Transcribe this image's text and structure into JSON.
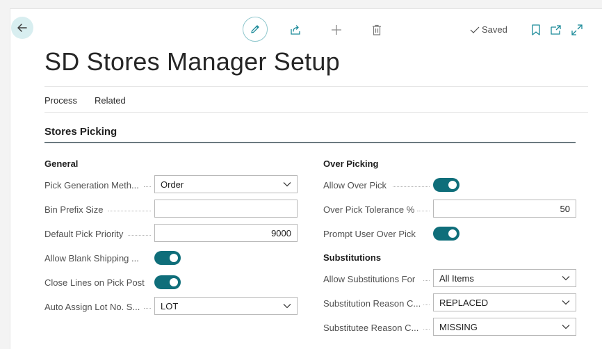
{
  "header": {
    "saved_label": "Saved"
  },
  "page_title": "SD Stores Manager Setup",
  "actions": {
    "process": "Process",
    "related": "Related"
  },
  "section": {
    "title": "Stores Picking"
  },
  "general": {
    "title": "General",
    "pick_generation_method": {
      "label": "Pick Generation Meth...",
      "value": "Order"
    },
    "bin_prefix_size": {
      "label": "Bin Prefix Size",
      "value": ""
    },
    "default_pick_priority": {
      "label": "Default Pick Priority",
      "value": "9000"
    },
    "allow_blank_shipping": {
      "label": "Allow Blank Shipping ...",
      "on": true
    },
    "close_lines_on_pick_post": {
      "label": "Close Lines on Pick Post",
      "on": true
    },
    "auto_assign_lot": {
      "label": "Auto Assign Lot No. S...",
      "value": "LOT"
    }
  },
  "over_picking": {
    "title": "Over Picking",
    "allow_over_pick": {
      "label": "Allow Over Pick",
      "on": true
    },
    "over_pick_tolerance": {
      "label": "Over Pick Tolerance %",
      "value": "50"
    },
    "prompt_user_over_pick": {
      "label": "Prompt User Over Pick",
      "on": true
    }
  },
  "substitutions": {
    "title": "Substitutions",
    "allow_substitutions_for": {
      "label": "Allow Substitutions For",
      "value": "All Items"
    },
    "substitution_reason_code": {
      "label": "Substitution Reason C...",
      "value": "REPLACED"
    },
    "substitutee_reason_code": {
      "label": "Substitutee Reason C...",
      "value": "MISSING"
    }
  },
  "colors": {
    "accent": "#0f6e7a",
    "icon": "#1b8a99"
  }
}
